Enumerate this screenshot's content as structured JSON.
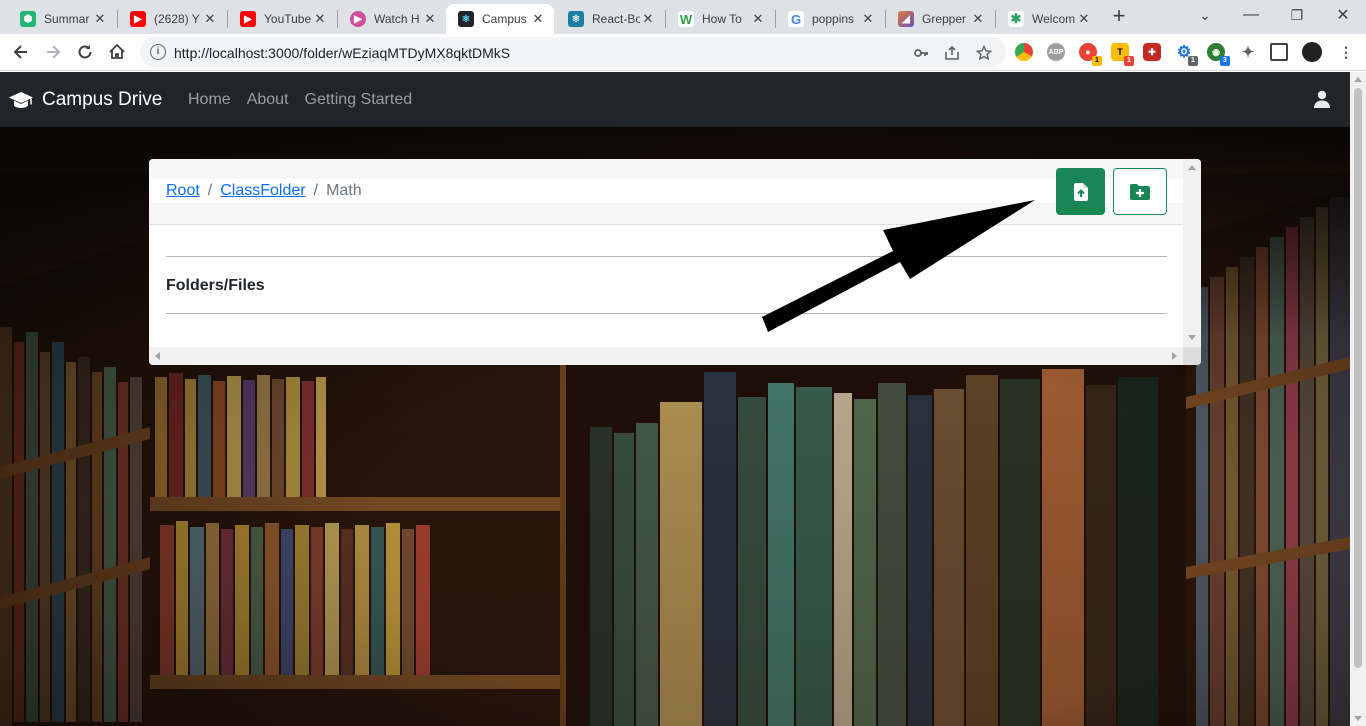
{
  "browser": {
    "tabs": [
      {
        "title": "Summar",
        "favicon": "hexagon-icon",
        "color": "#22b573"
      },
      {
        "title": "(2628) Y",
        "favicon": "youtube-icon",
        "color": "#ff0000"
      },
      {
        "title": "YouTube",
        "favicon": "youtube-icon",
        "color": "#ff0000"
      },
      {
        "title": "Watch H",
        "favicon": "play-circle-icon",
        "color": "#d04f9a"
      },
      {
        "title": "Campus",
        "favicon": "react-icon",
        "color": "#61dafb",
        "active": true
      },
      {
        "title": "React-Bo",
        "favicon": "react-bootstrap-icon",
        "color": "#1b7da0"
      },
      {
        "title": "How To",
        "favicon": "w-icon",
        "color": "#2f9e44"
      },
      {
        "title": "poppins",
        "favicon": "google-icon",
        "color": "#4285f4"
      },
      {
        "title": "Grepper",
        "favicon": "grepper-icon",
        "color": "#e07b39"
      },
      {
        "title": "Welcom",
        "favicon": "welcome-icon",
        "color": "#2c9f6b"
      }
    ],
    "url": "http://localhost:3000/folder/wEziaqMTDyMX8qktDMkS",
    "extension_badges": [
      "1",
      "1",
      "1",
      "3"
    ]
  },
  "app": {
    "brand": "Campus Drive",
    "nav": [
      "Home",
      "About",
      "Getting Started"
    ]
  },
  "folder": {
    "breadcrumb": [
      "Root",
      "ClassFolder",
      "Math"
    ],
    "section_title": "Folders/Files"
  },
  "colors": {
    "navbar": "#212529",
    "success": "#198754",
    "link": "#0d6efd"
  }
}
